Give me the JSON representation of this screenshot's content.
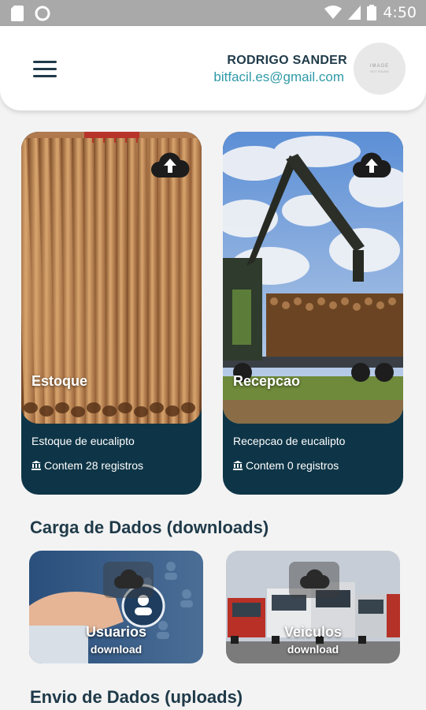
{
  "status_bar": {
    "time": "4:50",
    "icons": [
      "sd-card-icon",
      "circle-icon",
      "wifi-icon",
      "signal-icon",
      "battery-icon"
    ]
  },
  "header": {
    "user_name": "RODRIGO SANDER",
    "user_email": "bitfacil.es@gmail.com",
    "avatar_text": "IMAGE",
    "avatar_subtext": "NOT FOUND"
  },
  "cards": [
    {
      "title": "Estoque",
      "description": "Estoque de eucalipto",
      "count_text": "Contem 28 registros"
    },
    {
      "title": "Recepcao",
      "description": "Recepcao de eucalipto",
      "count_text": "Contem 0 registros"
    }
  ],
  "downloads_section": {
    "title": "Carga de Dados (downloads)",
    "items": [
      {
        "title": "Usuarios",
        "subtitle": "download"
      },
      {
        "title": "Veiculos",
        "subtitle": "download"
      }
    ]
  },
  "uploads_section": {
    "title": "Envio de Dados (uploads)"
  },
  "colors": {
    "dark_teal": "#0e3547",
    "title_text": "#1f3a49",
    "email_accent": "#2f9aa8",
    "status_bar": "#a9a9a9"
  }
}
